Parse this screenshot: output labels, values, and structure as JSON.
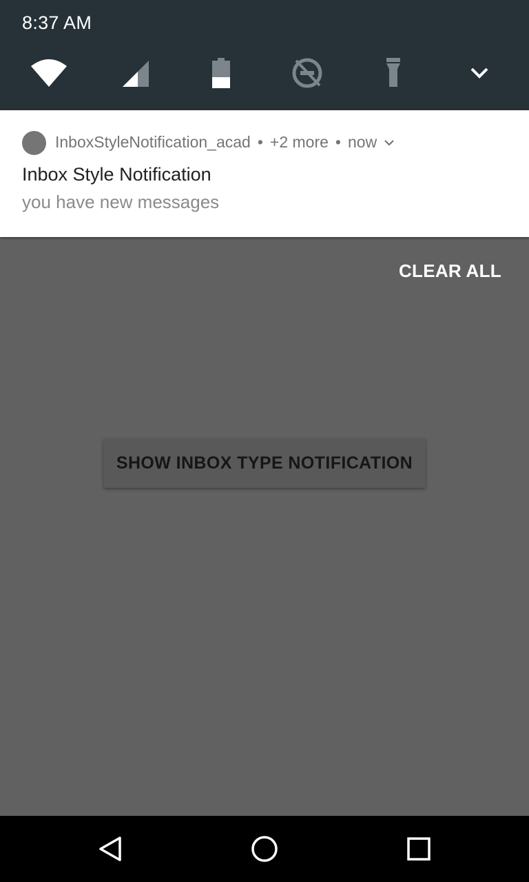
{
  "status_bar": {
    "time": "8:37 AM"
  },
  "quick_settings": {
    "icons": [
      "wifi-icon",
      "cellular-signal-icon",
      "battery-icon",
      "data-saver-off-icon",
      "flashlight-icon",
      "expand-chevron-icon"
    ]
  },
  "notification": {
    "app_name": "InboxStyleNotification_acad",
    "separator": "•",
    "more": "+2 more",
    "time": "now",
    "title": "Inbox Style Notification",
    "text": "you have new  messages"
  },
  "shade_actions": {
    "clear_all": "CLEAR ALL"
  },
  "app": {
    "button_label": "SHOW INBOX TYPE NOTIFICATION"
  },
  "colors": {
    "shade_bg": "#263238",
    "scrim_bg": "#616161",
    "card_bg": "#ffffff",
    "nav_bg": "#000000"
  }
}
